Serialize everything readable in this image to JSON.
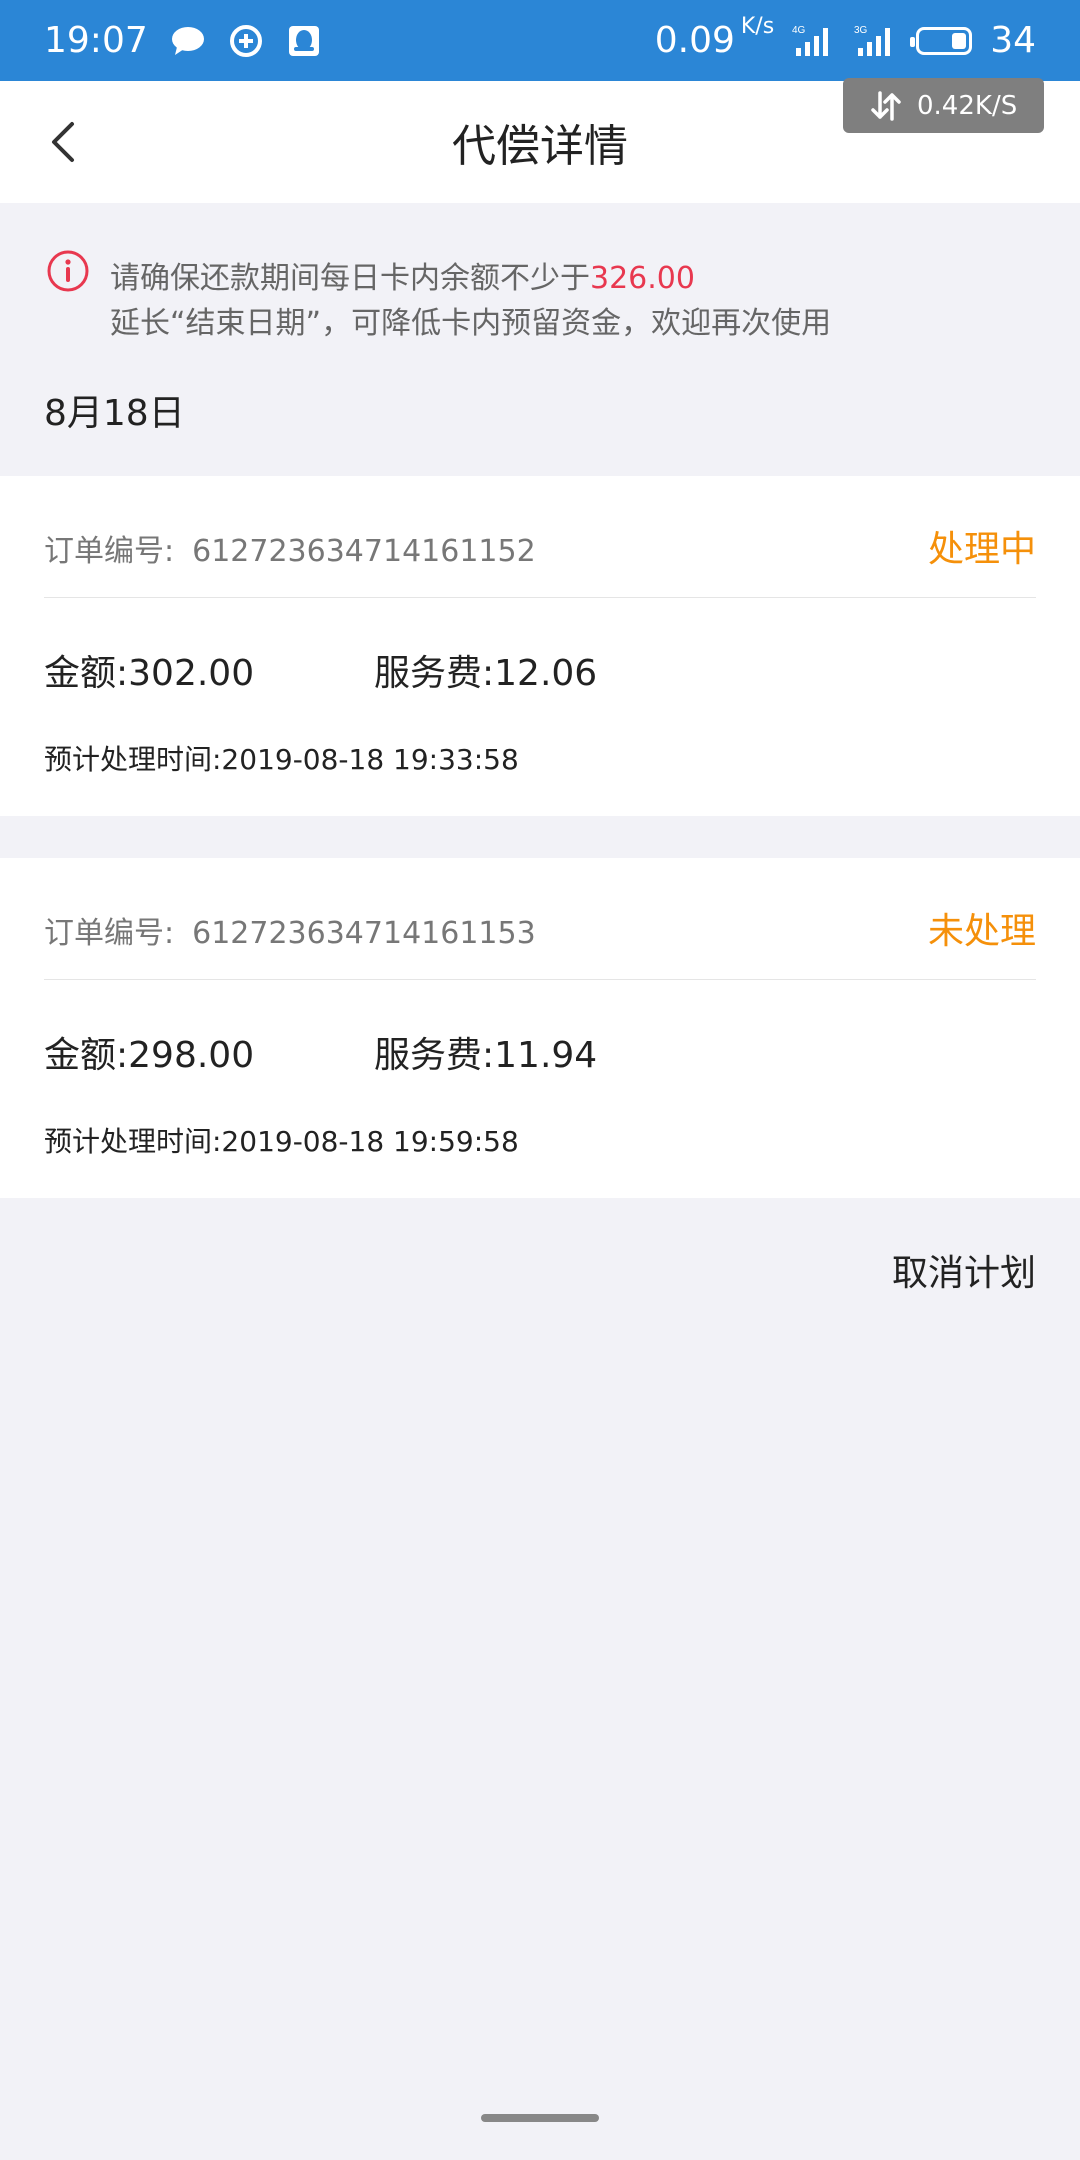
{
  "status_bar": {
    "time": "19:07",
    "net_speed": "0.09",
    "net_unit": "K/s",
    "signal_1": "4G",
    "signal_2": "3G",
    "battery": "34"
  },
  "overlay": {
    "speed": "0.42K/S"
  },
  "header": {
    "title": "代偿详情"
  },
  "notice": {
    "line1_prefix": "请确保还款期间每日卡内余额不少于",
    "line1_amount": "326.00",
    "line2": "延长“结束日期”，可降低卡内预留资金，欢迎再次使用"
  },
  "date_heading": "8月18日",
  "orders": [
    {
      "order_label": "订单编号:",
      "order_no": "612723634714161152",
      "status": "处理中",
      "amount": "金额:302.00",
      "fee": "服务费:12.06",
      "time": "预计处理时间:2019-08-18 19:33:58"
    },
    {
      "order_label": "订单编号:",
      "order_no": "612723634714161153",
      "status": "未处理",
      "amount": "金额:298.00",
      "fee": "服务费:11.94",
      "time": "预计处理时间:2019-08-18 19:59:58"
    }
  ],
  "cancel_plan": "取消计划",
  "colors": {
    "status_bar": "#2b86d6",
    "status_orange": "#f5900a",
    "warning_red": "#e8384f",
    "background": "#f2f2f7"
  }
}
